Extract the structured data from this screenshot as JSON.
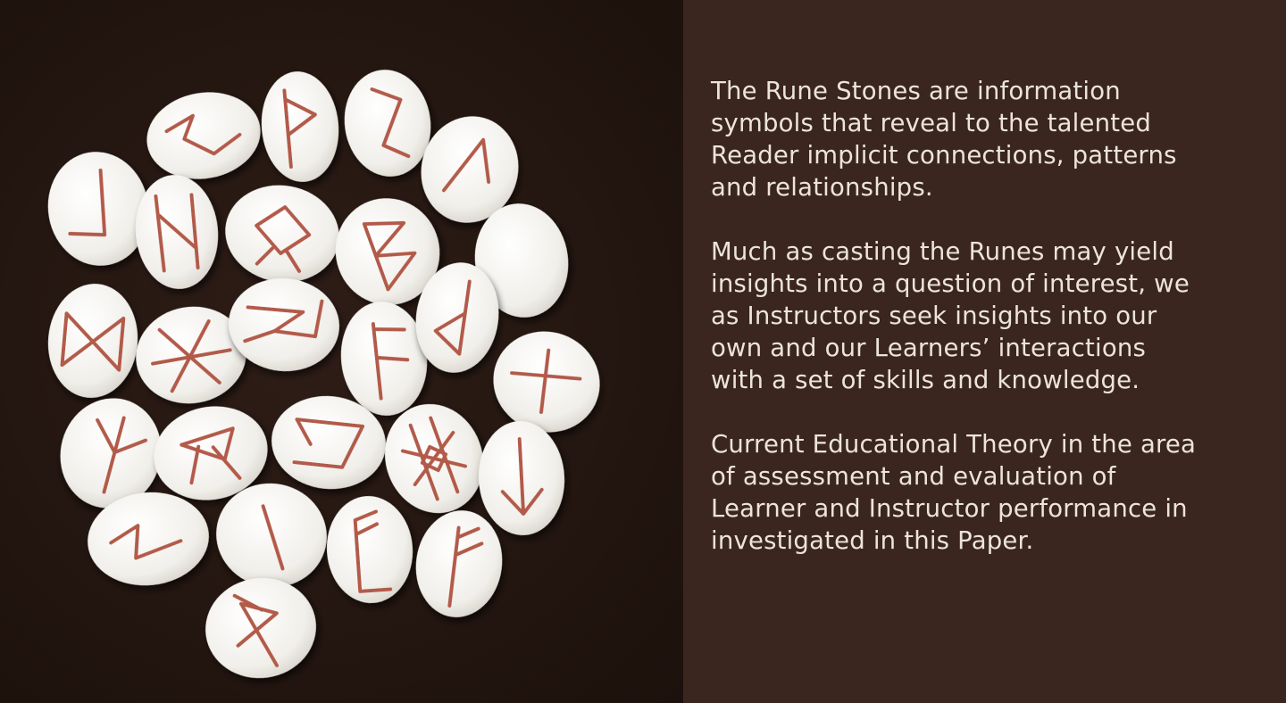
{
  "paragraphs": [
    "The Rune Stones are information\nsymbols that reveal to the talented\nReader implicit connections, patterns\nand relationships.",
    "Much as casting the Runes may yield\ninsights into a question of interest, we\nas Instructors seek insights into our\nown and our Learners’ interactions\nwith a set of skills and knowledge.",
    "Current Educational Theory in the area\nof assessment and evaluation of\nLearner and Instructor performance in\ninvestigated in this Paper."
  ],
  "colors": {
    "text_panel_background": "#3a261e",
    "text_color": "#ece4dc",
    "stone_color": "#f3f1ec",
    "rune_color": "#b35a48"
  },
  "photo": {
    "subject": "rune-stones",
    "stone_count": 25
  }
}
